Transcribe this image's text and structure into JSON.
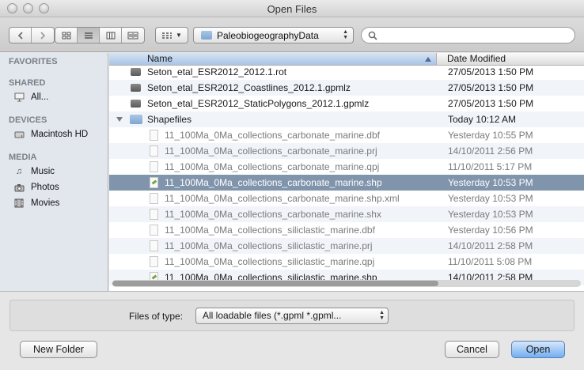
{
  "window": {
    "title": "Open Files"
  },
  "toolbar": {
    "location": "PaleobiogeographyData",
    "search_placeholder": ""
  },
  "sidebar": {
    "favorites_header": "FAVORITES",
    "shared_header": "SHARED",
    "shared_items": [
      {
        "label": "All...",
        "icon": "network-icon"
      }
    ],
    "devices_header": "DEVICES",
    "device_items": [
      {
        "label": "Macintosh HD",
        "icon": "hard-drive-icon"
      }
    ],
    "media_header": "MEDIA",
    "media_items": [
      {
        "label": "Music",
        "icon": "music-note-icon"
      },
      {
        "label": "Photos",
        "icon": "camera-icon"
      },
      {
        "label": "Movies",
        "icon": "film-icon"
      }
    ]
  },
  "list": {
    "columns": {
      "name": "Name",
      "date": "Date Modified"
    },
    "rows": [
      {
        "name": "Seton_etal_ESR2012_2012.1.rot",
        "date": "27/05/2013 1:50 PM",
        "kind": "file",
        "icon": "dark"
      },
      {
        "name": "Seton_etal_ESR2012_Coastlines_2012.1.gpmlz",
        "date": "27/05/2013 1:50 PM",
        "kind": "file",
        "icon": "dark"
      },
      {
        "name": "Seton_etal_ESR2012_StaticPolygons_2012.1.gpmlz",
        "date": "27/05/2013 1:50 PM",
        "kind": "file",
        "icon": "dark"
      },
      {
        "name": "Shapefiles",
        "date": "Today 10:12 AM",
        "kind": "folder",
        "icon": "folder"
      },
      {
        "name": "11_100Ma_0Ma_collections_carbonate_marine.dbf",
        "date": "Yesterday 10:55 PM",
        "kind": "child",
        "icon": "doc",
        "dim": true
      },
      {
        "name": "11_100Ma_0Ma_collections_carbonate_marine.prj",
        "date": "14/10/2011 2:56 PM",
        "kind": "child",
        "icon": "doc",
        "dim": true
      },
      {
        "name": "11_100Ma_0Ma_collections_carbonate_marine.qpj",
        "date": "11/10/2011 5:17 PM",
        "kind": "child",
        "icon": "doc",
        "dim": true
      },
      {
        "name": "11_100Ma_0Ma_collections_carbonate_marine.shp",
        "date": "Yesterday 10:53 PM",
        "kind": "child",
        "icon": "shp",
        "selected": true
      },
      {
        "name": "11_100Ma_0Ma_collections_carbonate_marine.shp.xml",
        "date": "Yesterday 10:53 PM",
        "kind": "child",
        "icon": "doc",
        "dim": true
      },
      {
        "name": "11_100Ma_0Ma_collections_carbonate_marine.shx",
        "date": "Yesterday 10:53 PM",
        "kind": "child",
        "icon": "doc",
        "dim": true
      },
      {
        "name": "11_100Ma_0Ma_collections_siliclastic_marine.dbf",
        "date": "Yesterday 10:56 PM",
        "kind": "child",
        "icon": "doc",
        "dim": true
      },
      {
        "name": "11_100Ma_0Ma_collections_siliclastic_marine.prj",
        "date": "14/10/2011 2:58 PM",
        "kind": "child",
        "icon": "doc",
        "dim": true
      },
      {
        "name": "11_100Ma_0Ma_collections_siliclastic_marine.qpj",
        "date": "11/10/2011 5:08 PM",
        "kind": "child",
        "icon": "doc",
        "dim": true
      },
      {
        "name": "11_100Ma_0Ma_collections_siliclastic_marine.shp",
        "date": "14/10/2011 2:58 PM",
        "kind": "child",
        "icon": "shp"
      }
    ]
  },
  "filter": {
    "label": "Files of type:",
    "selected": "All loadable files (*.gpml *.gpml..."
  },
  "buttons": {
    "new_folder": "New Folder",
    "cancel": "Cancel",
    "open": "Open"
  },
  "colors": {
    "selection": "#8094ac",
    "sidebar": "#e2e7ee",
    "default_button": "#73aef1"
  }
}
